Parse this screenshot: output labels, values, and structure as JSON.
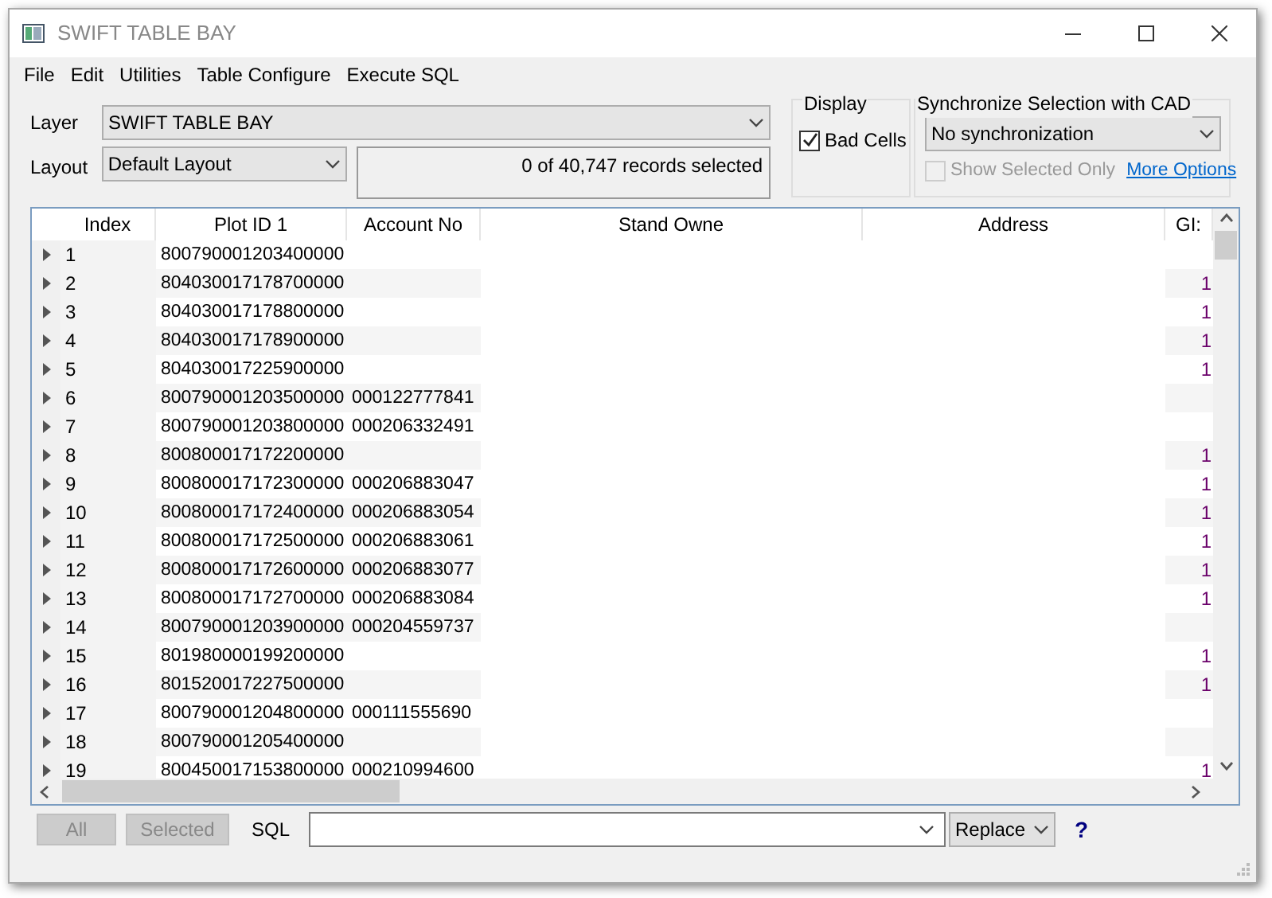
{
  "window": {
    "title": "SWIFT TABLE BAY"
  },
  "menu": [
    "File",
    "Edit",
    "Utilities",
    "Table Configure",
    "Execute SQL"
  ],
  "layer": {
    "label": "Layer",
    "value": "SWIFT TABLE BAY"
  },
  "layout": {
    "label": "Layout",
    "value": "Default Layout"
  },
  "records_status": "0 of 40,747 records selected",
  "display": {
    "title": "Display",
    "bad_cells": {
      "label": "Bad Cells",
      "checked": true
    }
  },
  "sync": {
    "title": "Synchronize Selection with CAD",
    "value": "No synchronization",
    "show_selected_only": {
      "label": "Show Selected Only",
      "checked": false,
      "disabled": true
    },
    "more_options": "More Options"
  },
  "table": {
    "columns": [
      "Index",
      "Plot ID 1",
      "Account No",
      "Stand Owne",
      "Address",
      "GI:"
    ],
    "rows": [
      {
        "index": "1",
        "plot_id": "800790001203400000"
      },
      {
        "index": "2",
        "plot_id": "804030017178700000",
        "gis": "1"
      },
      {
        "index": "3",
        "plot_id": "804030017178800000",
        "gis": "1"
      },
      {
        "index": "4",
        "plot_id": "804030017178900000",
        "gis": "1"
      },
      {
        "index": "5",
        "plot_id": "804030017225900000",
        "gis": "1"
      },
      {
        "index": "6",
        "plot_id": "800790001203500000",
        "account_no": "000122777841"
      },
      {
        "index": "7",
        "plot_id": "800790001203800000",
        "account_no": "000206332491"
      },
      {
        "index": "8",
        "plot_id": "800800017172200000",
        "gis": "1"
      },
      {
        "index": "9",
        "plot_id": "800800017172300000",
        "account_no": "000206883047",
        "gis": "1"
      },
      {
        "index": "10",
        "plot_id": "800800017172400000",
        "account_no": "000206883054",
        "gis": "1"
      },
      {
        "index": "11",
        "plot_id": "800800017172500000",
        "account_no": "000206883061",
        "gis": "1"
      },
      {
        "index": "12",
        "plot_id": "800800017172600000",
        "account_no": "000206883077",
        "gis": "1"
      },
      {
        "index": "13",
        "plot_id": "800800017172700000",
        "account_no": "000206883084",
        "gis": "1"
      },
      {
        "index": "14",
        "plot_id": "800790001203900000",
        "account_no": "000204559737"
      },
      {
        "index": "15",
        "plot_id": "801980000199200000",
        "gis": "1"
      },
      {
        "index": "16",
        "plot_id": "801520017227500000",
        "gis": "1"
      },
      {
        "index": "17",
        "plot_id": "800790001204800000",
        "account_no": "000111555690"
      },
      {
        "index": "18",
        "plot_id": "800790001205400000"
      },
      {
        "index": "19",
        "plot_id": "800450017153800000",
        "account_no": "000210994600",
        "gis": "1"
      }
    ]
  },
  "bottom_bar": {
    "all_button": {
      "label": "All",
      "disabled": true
    },
    "selected_button": {
      "label": "Selected",
      "disabled": true
    },
    "sql_label": "SQL",
    "mode": "Replace",
    "help": "?"
  }
}
